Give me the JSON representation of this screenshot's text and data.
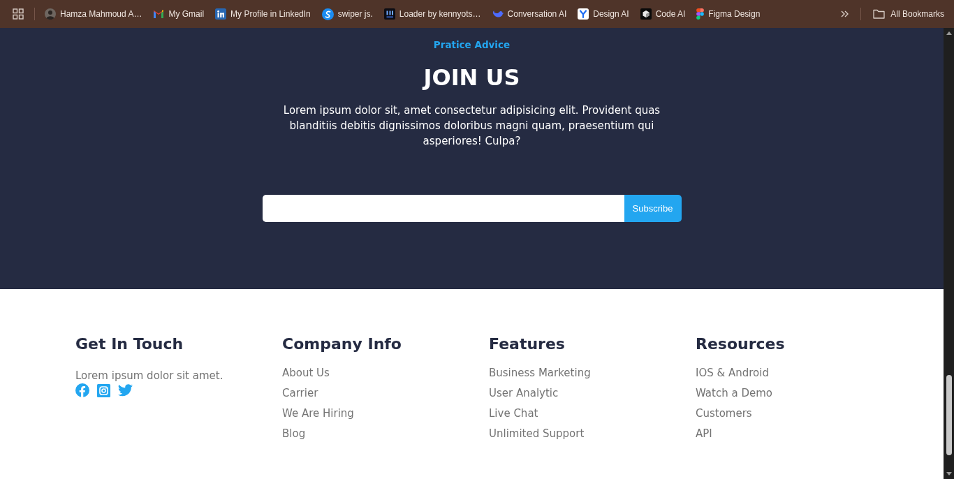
{
  "bookmarks_bar": {
    "items": [
      {
        "kind": "avatar",
        "label": "Hamza Mahmoud A…"
      },
      {
        "kind": "envelope",
        "label": "My Gmail"
      },
      {
        "kind": "badge",
        "label": "My Profile in LinkedIn"
      },
      {
        "kind": "swirl",
        "label": "swiper js."
      },
      {
        "kind": "tile",
        "label": "Loader by kennyots…"
      },
      {
        "kind": "whale",
        "label": "Conversation AI"
      },
      {
        "kind": "fork",
        "label": "Design AI"
      },
      {
        "kind": "cube",
        "label": "Code AI"
      },
      {
        "kind": "shapes",
        "label": "Figma Design"
      }
    ],
    "all_bookmarks": "All Bookmarks"
  },
  "join_section": {
    "eyebrow": "Pratice Advice",
    "title": "JOIN US",
    "text": "Lorem ipsum dolor sit, amet consectetur adipisicing elit. Provident quas blanditiis debitis dignissimos doloribus magni quam, praesentium qui asperiores! Culpa?",
    "subscribe_button": "Subscribe"
  },
  "footer": {
    "columns": [
      {
        "title": "Get In Touch",
        "text": "Lorem ipsum dolor sit amet.",
        "social": [
          {
            "kind": "facebook"
          },
          {
            "kind": "instagram"
          },
          {
            "kind": "twitter"
          }
        ]
      },
      {
        "title": "Company Info",
        "links": [
          "About Us",
          "Carrier",
          "We Are Hiring",
          "Blog"
        ]
      },
      {
        "title": "Features",
        "links": [
          "Business Marketing",
          "User Analytic",
          "Live Chat",
          "Unlimited Support"
        ]
      },
      {
        "title": "Resources",
        "links": [
          "IOS & Android",
          "Watch a Demo",
          "Customers",
          "API"
        ]
      }
    ]
  }
}
